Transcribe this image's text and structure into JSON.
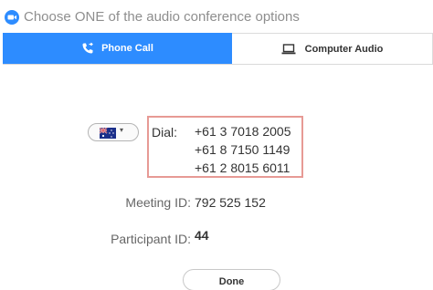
{
  "window": {
    "title": "Choose ONE of the audio conference options",
    "app_icon": "zoom-logo-icon"
  },
  "tabs": [
    {
      "label": "Phone Call",
      "icon": "phone-icon",
      "selected": true
    },
    {
      "label": "Computer Audio",
      "icon": "laptop-icon",
      "selected": false
    }
  ],
  "country_select": {
    "flag": "australia-flag-icon",
    "caret": "▾"
  },
  "dial": {
    "label": "Dial:",
    "numbers": [
      "+61 3 7018 2005",
      "+61 8 7150 1149",
      "+61 2 8015 6011"
    ]
  },
  "meeting": {
    "label": "Meeting ID:",
    "value": "792 525 152"
  },
  "participant": {
    "label": "Participant ID:",
    "value": "44"
  },
  "actions": {
    "done_label": "Done"
  },
  "colors": {
    "accent": "#2d8cff",
    "highlight_border": "#e79a95"
  }
}
